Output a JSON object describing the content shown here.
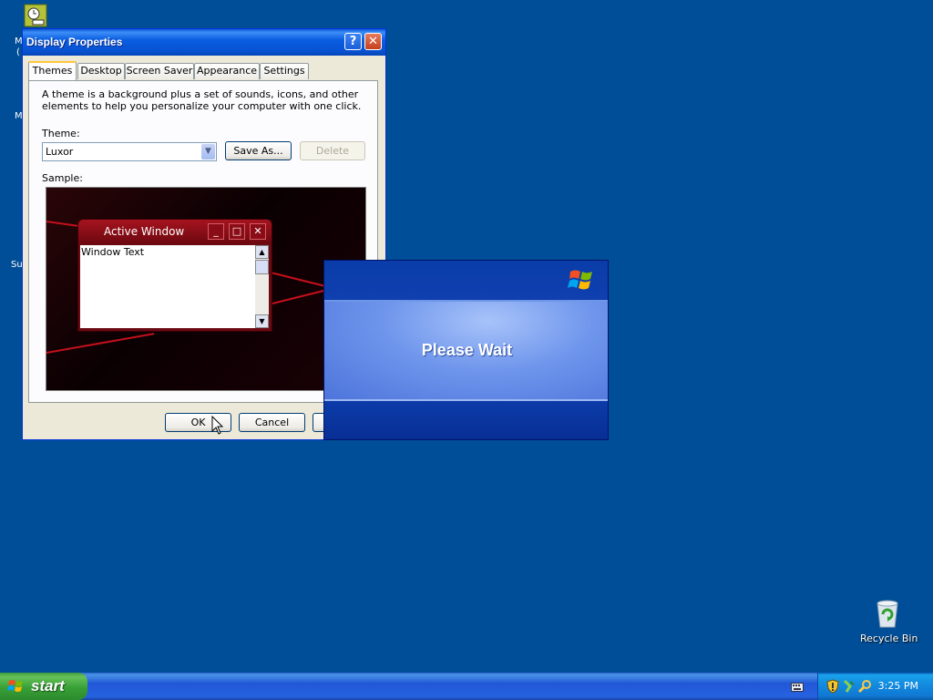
{
  "desktop": {
    "fragments": [
      "M",
      "(",
      "M",
      "Su"
    ],
    "recycle_bin": "Recycle Bin"
  },
  "display_properties": {
    "title": "Display Properties",
    "tabs": [
      "Themes",
      "Desktop",
      "Screen Saver",
      "Appearance",
      "Settings"
    ],
    "active_tab": "Themes",
    "description": "A theme is a background plus a set of sounds, icons, and other elements to help you personalize your computer with one click.",
    "theme_label": "Theme:",
    "theme_value": "Luxor",
    "save_as": "Save As...",
    "delete": "Delete",
    "sample_label": "Sample:",
    "sample_window_title": "Active Window",
    "sample_window_text": "Window Text",
    "ok": "OK",
    "cancel": "Cancel"
  },
  "please_wait": {
    "message": "Please Wait"
  },
  "taskbar": {
    "start": "start",
    "clock": "3:25 PM"
  }
}
